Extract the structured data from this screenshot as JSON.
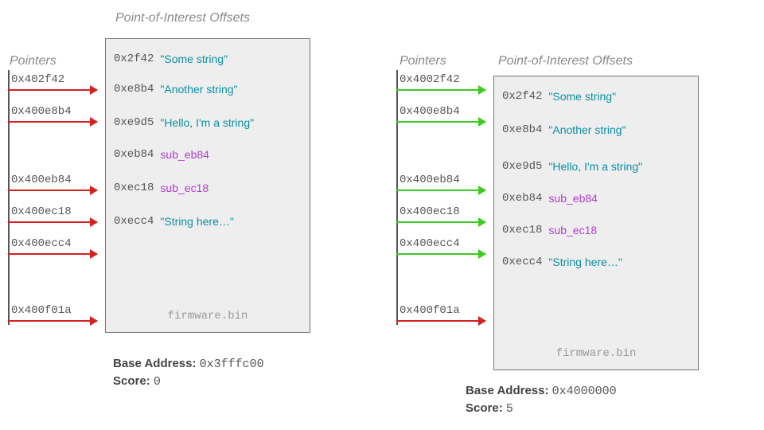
{
  "labels": {
    "pointers": "Pointers",
    "poi": "Point-of-Interest Offsets",
    "file": "firmware.bin",
    "base_label": "Base Address:",
    "score_label": "Score:"
  },
  "entries": [
    {
      "offset": "0x2f42",
      "text": "\"Some string\"",
      "kind": "str"
    },
    {
      "offset": "0xe8b4",
      "text": "\"Another string\"",
      "kind": "str"
    },
    {
      "offset": "0xe9d5",
      "text": "\"Hello, I'm a string\"",
      "kind": "str"
    },
    {
      "offset": "0xeb84",
      "text": "sub_eb84",
      "kind": "sub"
    },
    {
      "offset": "0xec18",
      "text": "sub_ec18",
      "kind": "sub"
    },
    {
      "offset": "0xecc4",
      "text": "\"String here…\"",
      "kind": "str"
    }
  ],
  "left": {
    "pointers": [
      "0x402f42",
      "0x400e8b4",
      "0x400eb84",
      "0x400ec18",
      "0x400ecc4",
      "0x400f01a"
    ],
    "base": "0x3fffc00",
    "score": "0"
  },
  "right": {
    "pointers": [
      "0x4002f42",
      "0x400e8b4",
      "0x400eb84",
      "0x400ec18",
      "0x400ecc4",
      "0x400f01a"
    ],
    "base": "0x4000000",
    "score": "5"
  }
}
